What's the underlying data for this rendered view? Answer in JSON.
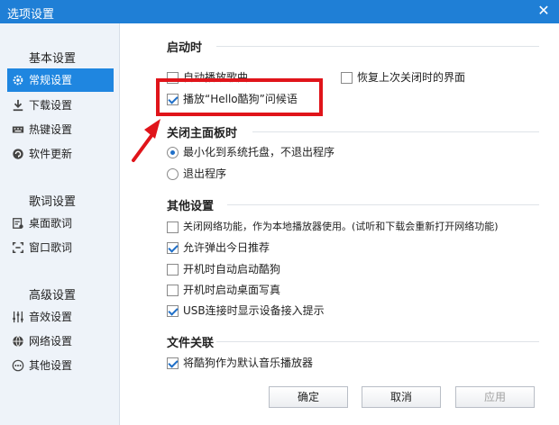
{
  "window": {
    "title": "选项设置"
  },
  "sidebar": {
    "groups": [
      {
        "title": "基本设置",
        "items": [
          {
            "label": "常规设置",
            "active": true,
            "icon": "gear-icon"
          },
          {
            "label": "下载设置",
            "icon": "download-icon"
          },
          {
            "label": "热键设置",
            "icon": "keyboard-icon"
          },
          {
            "label": "软件更新",
            "icon": "update-icon"
          }
        ]
      },
      {
        "title": "歌词设置",
        "items": [
          {
            "label": "桌面歌词",
            "icon": "desktop-lyrics-icon"
          },
          {
            "label": "窗口歌词",
            "icon": "window-lyrics-icon"
          }
        ]
      },
      {
        "title": "高级设置",
        "items": [
          {
            "label": "音效设置",
            "icon": "equalizer-icon"
          },
          {
            "label": "网络设置",
            "icon": "network-icon"
          },
          {
            "label": "其他设置",
            "icon": "more-icon"
          }
        ]
      }
    ]
  },
  "sections": {
    "startup": {
      "title": "启动时",
      "auto_play": {
        "label": "自动播放歌曲",
        "checked": false
      },
      "restore_ui": {
        "label": "恢复上次关闭时的界面",
        "checked": false
      },
      "play_greeting": {
        "label": "播放“Hello酷狗”问候语",
        "checked": true
      }
    },
    "close_panel": {
      "title": "关闭主面板时",
      "minimize": {
        "label": "最小化到系统托盘，不退出程序",
        "selected": true
      },
      "exit": {
        "label": "退出程序",
        "selected": false
      }
    },
    "other": {
      "title": "其他设置",
      "disable_network": {
        "label": "关闭网络功能，作为本地播放器使用。(试听和下载会重新打开网络功能)",
        "checked": false
      },
      "allow_popup": {
        "label": "允许弹出今日推荐",
        "checked": true
      },
      "autostart": {
        "label": "开机时自动启动酷狗",
        "checked": false
      },
      "desktop_photo": {
        "label": "开机时启动桌面写真",
        "checked": false
      },
      "usb_prompt": {
        "label": "USB连接时显示设备接入提示",
        "checked": true
      }
    },
    "file_assoc": {
      "title": "文件关联",
      "default_player": {
        "label": "将酷狗作为默认音乐播放器",
        "checked": true
      }
    }
  },
  "buttons": {
    "ok": "确定",
    "cancel": "取消",
    "apply": "应用"
  },
  "colors": {
    "accent": "#1f86e0",
    "titlebar": "#1f7fd6",
    "highlight": "#e0141a"
  }
}
